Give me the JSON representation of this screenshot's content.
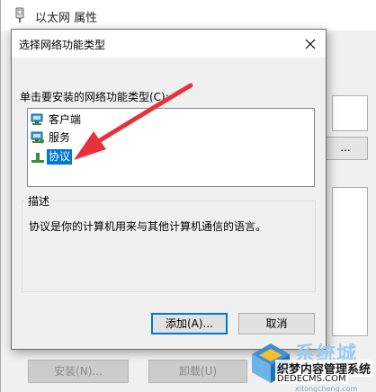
{
  "background_window": {
    "title": "以太网 属性",
    "dots_button": "...",
    "install_button": "安装(N)...",
    "uninstall_button": "卸载(U)"
  },
  "dialog": {
    "title": "选择网络功能类型",
    "prompt": "单击要安装的网络功能类型(C):",
    "items": [
      {
        "label": "客户端",
        "icon": "client-network-icon",
        "selected": false
      },
      {
        "label": "服务",
        "icon": "service-network-icon",
        "selected": false
      },
      {
        "label": "协议",
        "icon": "protocol-network-icon",
        "selected": true
      }
    ],
    "group_label": "描述",
    "description": "协议是你的计算机用来与其他计算机通信的语言。",
    "add_button": "添加(A)...",
    "cancel_button": "取消"
  },
  "watermark": {
    "title": "系统城",
    "line1": "织梦内容管理系统",
    "line2": "DEDECMS.COM",
    "line3": "xitongcheng.com"
  },
  "colors": {
    "selection": "#0078d7",
    "arrow": "#e8313a"
  }
}
